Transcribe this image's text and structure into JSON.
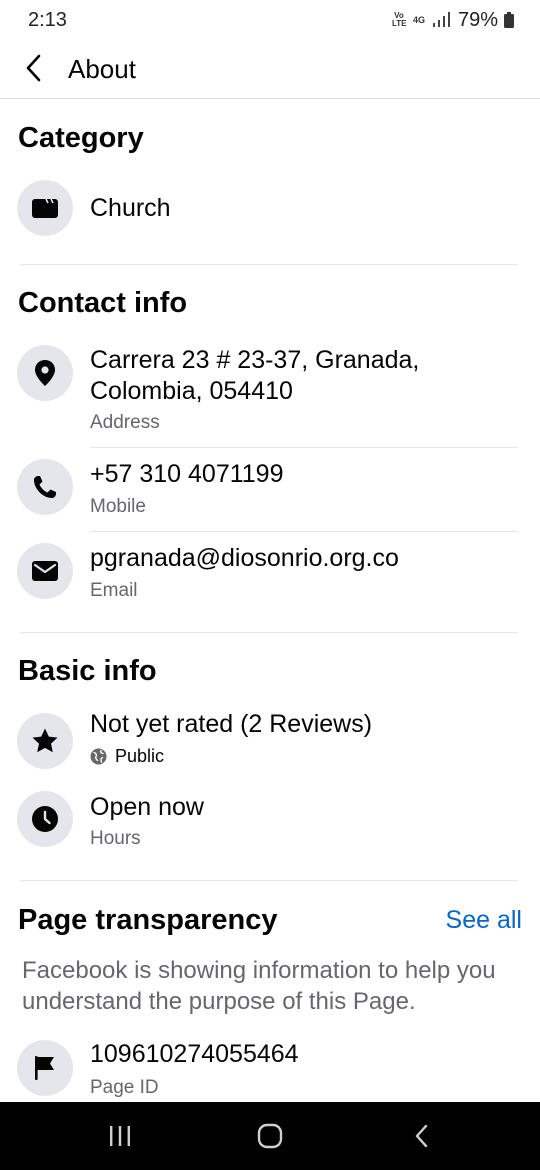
{
  "status_bar": {
    "time": "2:13",
    "volte": "Vo LTE",
    "network": "4G",
    "battery": "79%"
  },
  "header": {
    "title": "About",
    "back_icon": "chevron-left-icon"
  },
  "category": {
    "title": "Category",
    "items": [
      {
        "icon": "video-clapper-icon",
        "label": "Church"
      }
    ]
  },
  "contact_info": {
    "title": "Contact info",
    "address": {
      "icon": "location-pin-icon",
      "value_line1": "Carrera 23 # 23-37, Granada,",
      "value_line2": "Colombia, 054410",
      "label": "Address"
    },
    "mobile": {
      "icon": "phone-icon",
      "value": "+57 310 4071199",
      "label": "Mobile"
    },
    "email": {
      "icon": "envelope-icon",
      "value": "pgranada@diosonrio.org.co",
      "label": "Email"
    }
  },
  "basic_info": {
    "title": "Basic info",
    "rating": {
      "icon": "star-icon",
      "value": "Not yet rated (2 Reviews)",
      "privacy_icon": "globe-icon",
      "privacy": "Public"
    },
    "hours": {
      "icon": "clock-icon",
      "value": "Open now",
      "label": "Hours"
    }
  },
  "page_transparency": {
    "title": "Page transparency",
    "see_all": "See all",
    "description": "Facebook is showing information to help you understand the purpose of this Page.",
    "page_id": {
      "icon": "flag-icon",
      "value": "109610274055464",
      "label": "Page ID"
    }
  },
  "nav_bar": {
    "recents_icon": "recent-apps-icon",
    "home_icon": "home-icon",
    "back_icon": "back-icon"
  },
  "colors": {
    "link": "#0866c6",
    "secondary_text": "#65676b",
    "icon_background": "#e4e6eb"
  }
}
